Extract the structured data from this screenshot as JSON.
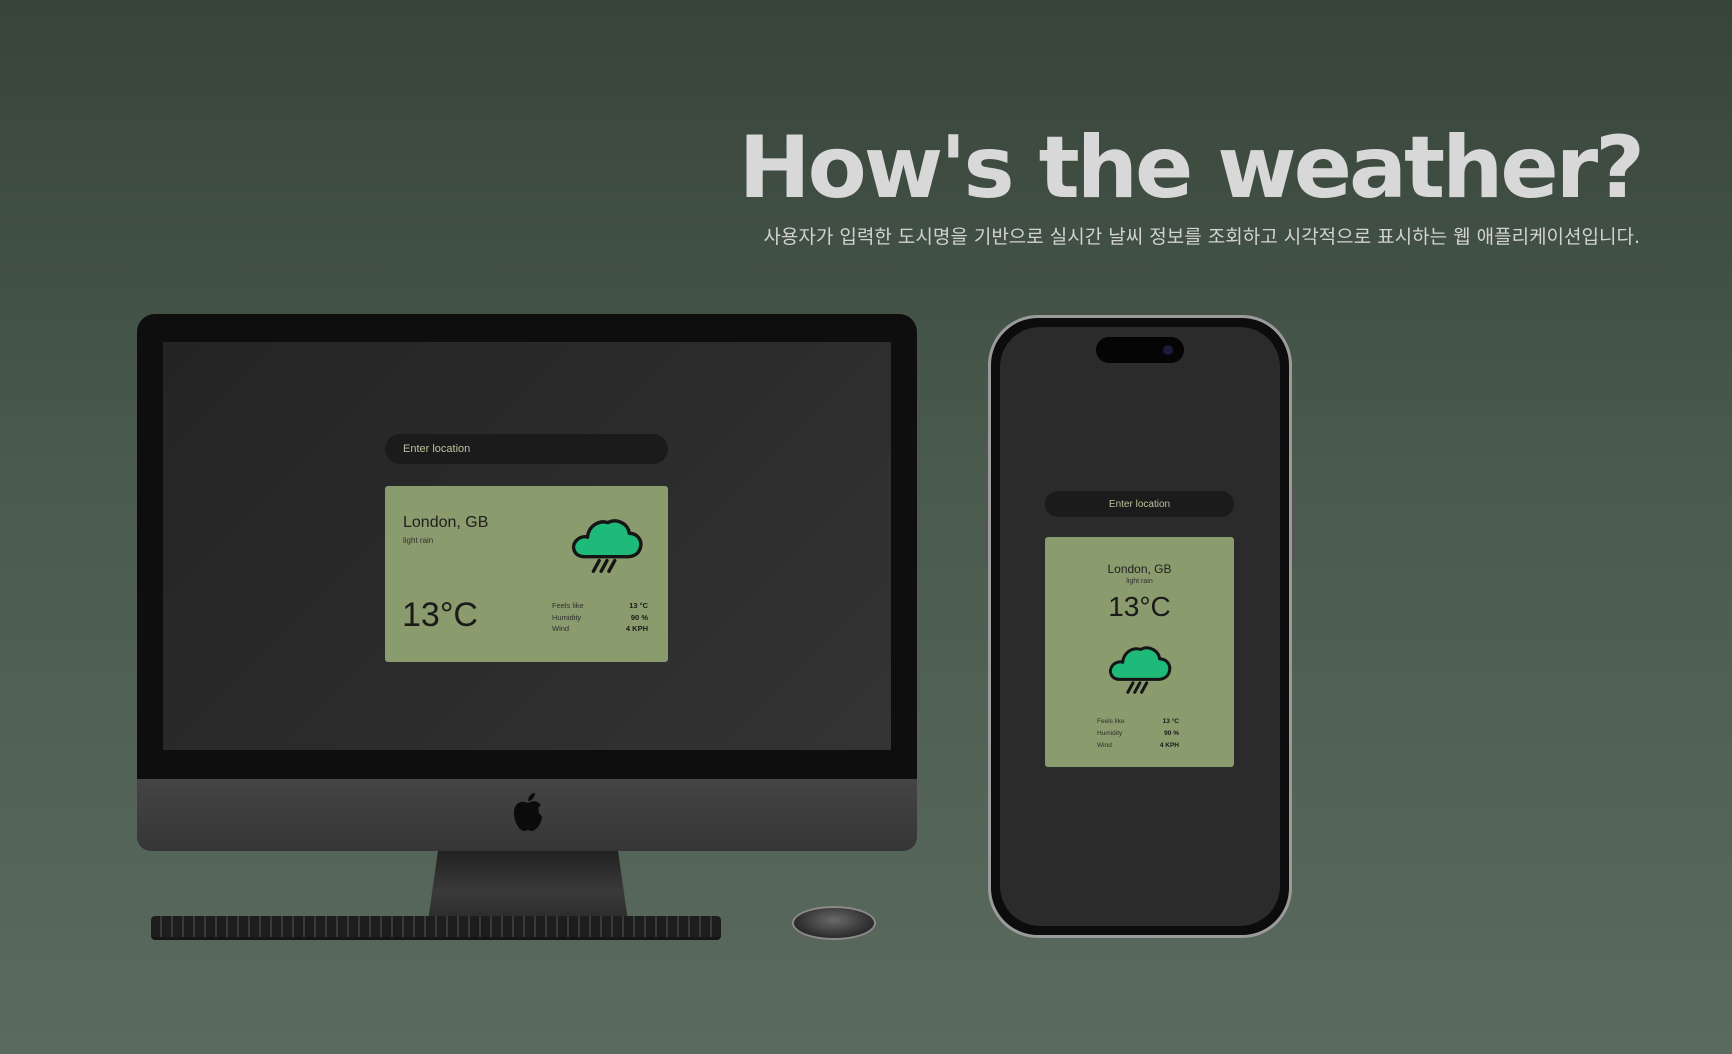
{
  "hero": {
    "title": "How's the weather?",
    "subtitle": "사용자가 입력한 도시명을 기반으로 실시간 날씨 정보를 조회하고 시각적으로 표시하는 웹 애플리케이션입니다."
  },
  "app": {
    "search": {
      "placeholder": "Enter location"
    },
    "weather": {
      "city": "London, GB",
      "condition": "light rain",
      "temperature": "13°C",
      "icon": "rain-cloud-icon",
      "details": [
        {
          "label": "Feels like",
          "value": "13 °C"
        },
        {
          "label": "Humidity",
          "value": "90 %"
        },
        {
          "label": "Wind",
          "value": "4 KPH"
        }
      ]
    }
  },
  "colors": {
    "background_top": "#37443a",
    "background_bottom": "#5b6a5e",
    "card": "#8a9b6d",
    "icon_green": "#1fb97a",
    "app_background": "#2b2b2b"
  }
}
